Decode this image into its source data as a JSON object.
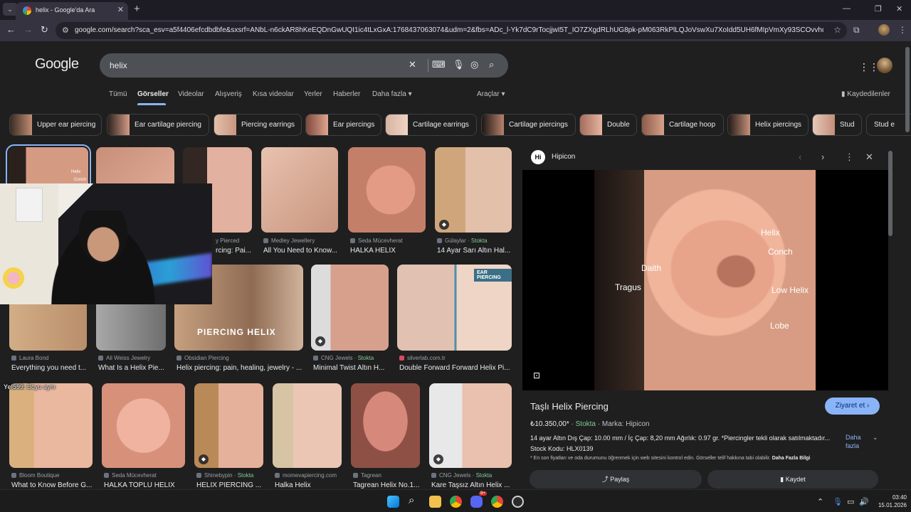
{
  "browser": {
    "tab_title": "helix - Google'da Ara",
    "url": "google.com/search?sca_esv=a5f4406efcdbdbfe&sxsrf=ANbL-n6ckAR8hKeEQDnGwUQI1ic4tLxGxA:1768437063074&udm=2&fbs=ADc_l-Yk7dC9rTocjjwI5T_IO7ZXgdRLhUG8pk-pM063RkPlLQJoVswXu7XoIdd5UH6fMIpVmXy93SCOvvhdXj3IBBc6ULDr0rdqW0..."
  },
  "google": {
    "logo": "Google",
    "query": "helix",
    "tabs": [
      {
        "label": "Tümü"
      },
      {
        "label": "Görseller"
      },
      {
        "label": "Videolar"
      },
      {
        "label": "Alışveriş"
      },
      {
        "label": "Kısa videolar"
      },
      {
        "label": "Yerler"
      },
      {
        "label": "Haberler"
      },
      {
        "label": "Daha fazla ▾"
      }
    ],
    "tools": "Araçlar ▾",
    "saved": "Kaydedilenler"
  },
  "chips": [
    {
      "label": "Upper ear piercing"
    },
    {
      "label": "Ear cartilage piercing"
    },
    {
      "label": "Piercing earrings"
    },
    {
      "label": "Ear piercings"
    },
    {
      "label": "Cartilage earrings"
    },
    {
      "label": "Cartilage piercings"
    },
    {
      "label": "Double"
    },
    {
      "label": "Cartilage hoop"
    },
    {
      "label": "Helix piercings"
    },
    {
      "label": "Stud"
    },
    {
      "label": "Stud e"
    }
  ],
  "results": [
    {
      "source": "",
      "title": "",
      "stock": ""
    },
    {
      "source": "",
      "title": "",
      "stock": ""
    },
    {
      "source": "y Pierced",
      "title": "rcing: Pai...",
      "stock": ""
    },
    {
      "source": "Medley Jewellery",
      "title": "All You Need to Know...",
      "stock": ""
    },
    {
      "source": "Seda Mücevherat",
      "title": "HALKA HELIX",
      "stock": ""
    },
    {
      "source": "Gülaylar",
      "title": "14 Ayar Sarı Altın Hal...",
      "stock": "Stokta"
    },
    {
      "source": "Laura Bond",
      "title": "Everything you need t...",
      "stock": ""
    },
    {
      "source": "Ali Weiss Jewelry",
      "title": "What Is a Helix Pie...",
      "stock": ""
    },
    {
      "source": "Obsidian Piercing",
      "title": "Helix piercing: pain, healing, jewelry - ...",
      "stock": ""
    },
    {
      "source": "CNG Jewels",
      "title": "Minimal Twist Altın H...",
      "stock": "Stokta"
    },
    {
      "source": "silverlab.com.tr",
      "title": "Double Forward Forward Helix Pi...",
      "stock": ""
    },
    {
      "source": "Bloom Boutique",
      "title": "What to Know Before G...",
      "stock": ""
    },
    {
      "source": "Seda Mücevherat",
      "title": "HALKA TOPLU HELIX",
      "stock": ""
    },
    {
      "source": "Shinebypin",
      "title": "HELİX PİERCİNG ...",
      "stock": "Stokta"
    },
    {
      "source": "momevapiercing.com",
      "title": "Halka Helix",
      "stock": ""
    },
    {
      "source": "Tagrean",
      "title": "Tagrean Helix No.1...",
      "stock": ""
    },
    {
      "source": "CNG Jewels",
      "title": "Kare Taşsız Altın Helix ...",
      "stock": "Stokta"
    }
  ],
  "thumb_text": {
    "piercing_helix": "PIERCING HELIX",
    "ear_piercing": "EAR PIERCING",
    "helix": "Helix",
    "conch": "Conch"
  },
  "stream": {
    "viewer": "Yel599",
    "message": ": Boyu aynı"
  },
  "preview": {
    "site": "Hipicon",
    "site_logo": "Hi",
    "labels": {
      "helix": "Helix",
      "conch": "Conch",
      "daith": "Daith",
      "tragus": "Tragus",
      "low_helix": "Low Helix",
      "lobe": "Lobe"
    },
    "title": "Taşlı Helix Piercing",
    "visit": "Ziyaret et ›",
    "price": "₺10.350,00*",
    "stock": "Stokta",
    "brand": "Marka: Hipicon",
    "description": "14 ayar Altın Dış Çap: 10.00 mm / İç Çap: 8,20 mm Ağırlık: 0.97 gr. *Piercingler tekli olarak satılmaktadır...",
    "sku": "Stock Kodu: HLX0139",
    "more": "Daha fazla",
    "note": "* En son fiyatları ve oda durumunu öğrenmek için web sitesini kontrol edin. Görseller telif hakkına tabi olabilir.",
    "note_link": "Daha Fazla Bilgi",
    "share": "Paylaş",
    "save": "Kaydet"
  },
  "taskbar": {
    "time": "03:40",
    "date": "15.01.2026",
    "notif_badge": "9+"
  },
  "colors": {
    "accent": "#8ab4f8",
    "stock_green": "#81c995",
    "page_bg": "#1f1f1f",
    "searchbox": "#4d5156"
  }
}
